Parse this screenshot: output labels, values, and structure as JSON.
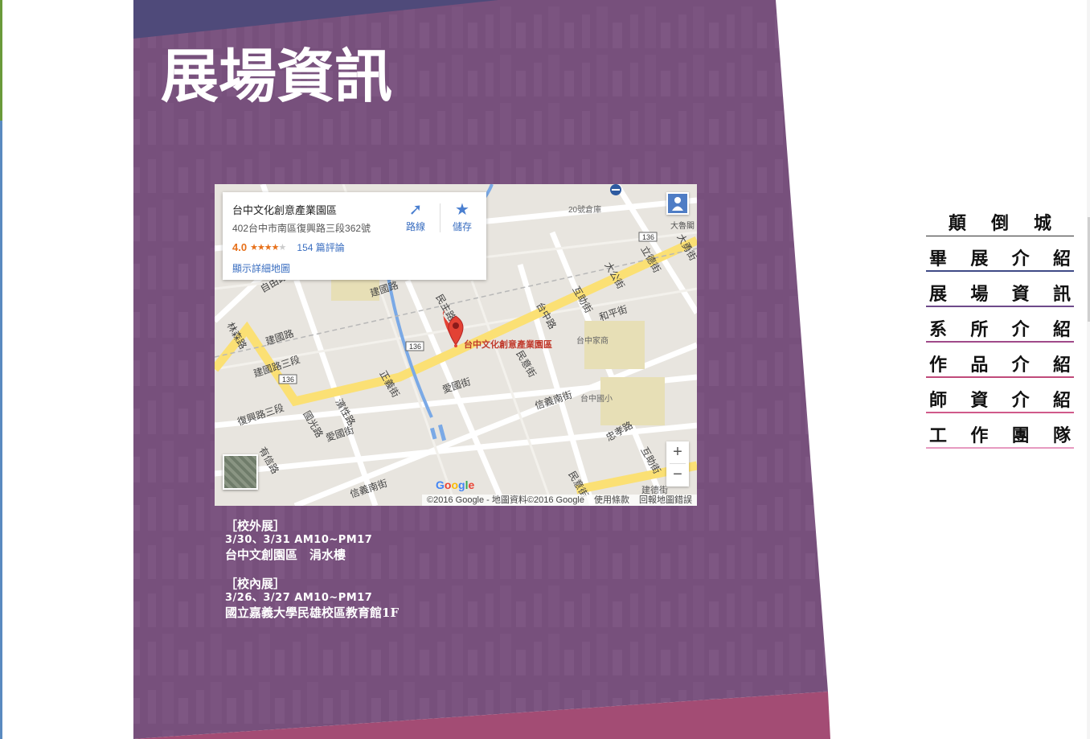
{
  "page": {
    "title": "展場資訊"
  },
  "map": {
    "place_name": "台中文化創意產業園區",
    "address": "402台中市南區復興路三段362號",
    "rating": "4.0",
    "rating_stars": 4,
    "reviews": "154 篇評論",
    "larger_map_link": "顯示詳細地圖",
    "directions_label": "路線",
    "save_label": "儲存",
    "marker_label": "台中文化創意產業園區",
    "zoom_in": "+",
    "zoom_out": "−",
    "logo": "Google",
    "attribution": "©2016 Google - 地圖資料©2016 Google",
    "terms": "使用條款",
    "report": "回報地圖錯誤",
    "road_labels": [
      "建國路",
      "自由路一段",
      "林森路",
      "建國路三段",
      "復興路三段",
      "有信路",
      "國光路",
      "愛國街",
      "濱性路",
      "正義街",
      "台中路",
      "民意街",
      "互助街",
      "和平街",
      "大公街",
      "立德街",
      "大勇街",
      "20號倉庫",
      "台中家商",
      "台中國小",
      "信義南街",
      "忠孝路",
      "民主路",
      "大魯閣",
      "建德街",
      "民意街",
      "136"
    ],
    "icons": {
      "directions": "directions-icon",
      "save": "star-icon",
      "pegman": "person-icon",
      "marker": "map-pin-icon"
    }
  },
  "events": [
    {
      "heading": "［校外展］",
      "date": "3/30、3/31 AM10~PM17",
      "venue": "台中文創園區　涓水樓"
    },
    {
      "heading": "［校內展］",
      "date": "3/26、3/27 AM10~PM17",
      "venue": "國立嘉義大學民雄校區教育館1F"
    }
  ],
  "nav": [
    {
      "label": "顛倒城",
      "color": "#2f2f2f"
    },
    {
      "label": "畢展介紹",
      "color": "#3f4a86"
    },
    {
      "label": "展場資訊",
      "color": "#6d4a8a"
    },
    {
      "label": "系所介紹",
      "color": "#a04a8a"
    },
    {
      "label": "作品介紹",
      "color": "#c04a7a"
    },
    {
      "label": "師資介紹",
      "color": "#d05a8a"
    },
    {
      "label": "工作團隊",
      "color": "#e79ac0"
    }
  ],
  "colors": {
    "panel": "#77507c",
    "top_band": "#4f4a7a",
    "bottom_band": "#a34c74",
    "road_major": "#fbe074",
    "map_bg": "#e8e5df",
    "marker": "#e34234"
  }
}
